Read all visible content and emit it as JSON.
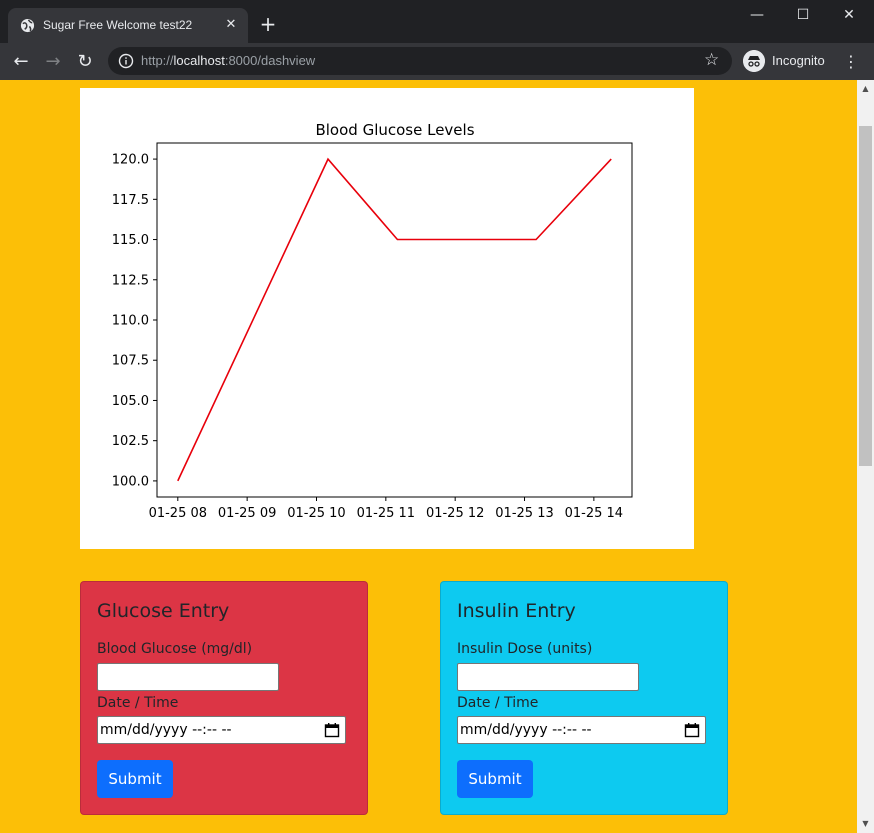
{
  "browser": {
    "tab_title": "Sugar Free Welcome test22",
    "url_scheme": "http://",
    "url_host": "localhost",
    "url_rest": ":8000/dashview",
    "incognito_label": "Incognito"
  },
  "chart_data": {
    "type": "line",
    "title": "Blood Glucose Levels",
    "x": [
      "2024-01-25 08:00",
      "2024-01-25 10:10",
      "2024-01-25 11:10",
      "2024-01-25 13:10",
      "2024-01-25 14:15"
    ],
    "series": [
      {
        "values": [
          100.0,
          120.0,
          115.0,
          115.0,
          120.0
        ],
        "color": "#e8000b"
      }
    ],
    "xticks": [
      "01-25 08",
      "01-25 09",
      "01-25 10",
      "01-25 11",
      "01-25 12",
      "01-25 13",
      "01-25 14"
    ],
    "yticks": [
      "100.0",
      "102.5",
      "105.0",
      "107.5",
      "110.0",
      "112.5",
      "115.0",
      "117.5",
      "120.0"
    ],
    "ylim": [
      99.0,
      121.0
    ],
    "grid": false
  },
  "glucose": {
    "title": "Glucose Entry",
    "field_label": "Blood Glucose (mg/dl)",
    "field_value": "",
    "datetime_label": "Date / Time",
    "datetime_placeholder": "mm/dd/yyyy --:-- --",
    "submit_label": "Submit",
    "color": "#dc3545"
  },
  "insulin": {
    "title": "Insulin Entry",
    "field_label": "Insulin Dose (units)",
    "field_value": "",
    "datetime_label": "Date / Time",
    "datetime_placeholder": "mm/dd/yyyy --:-- --",
    "submit_label": "Submit",
    "color": "#0dcaf0"
  },
  "page_background": "#fcbf07",
  "icons": {
    "tab_favicon": "globe-icon",
    "tab_close": "close-icon",
    "new_tab": "plus-icon",
    "back": "back-arrow-icon",
    "forward": "forward-arrow-icon",
    "reload": "reload-icon",
    "site_info": "info-icon",
    "bookmark": "star-icon",
    "incognito": "incognito-icon",
    "menu": "kebab-menu-icon",
    "calendar": "calendar-icon"
  }
}
